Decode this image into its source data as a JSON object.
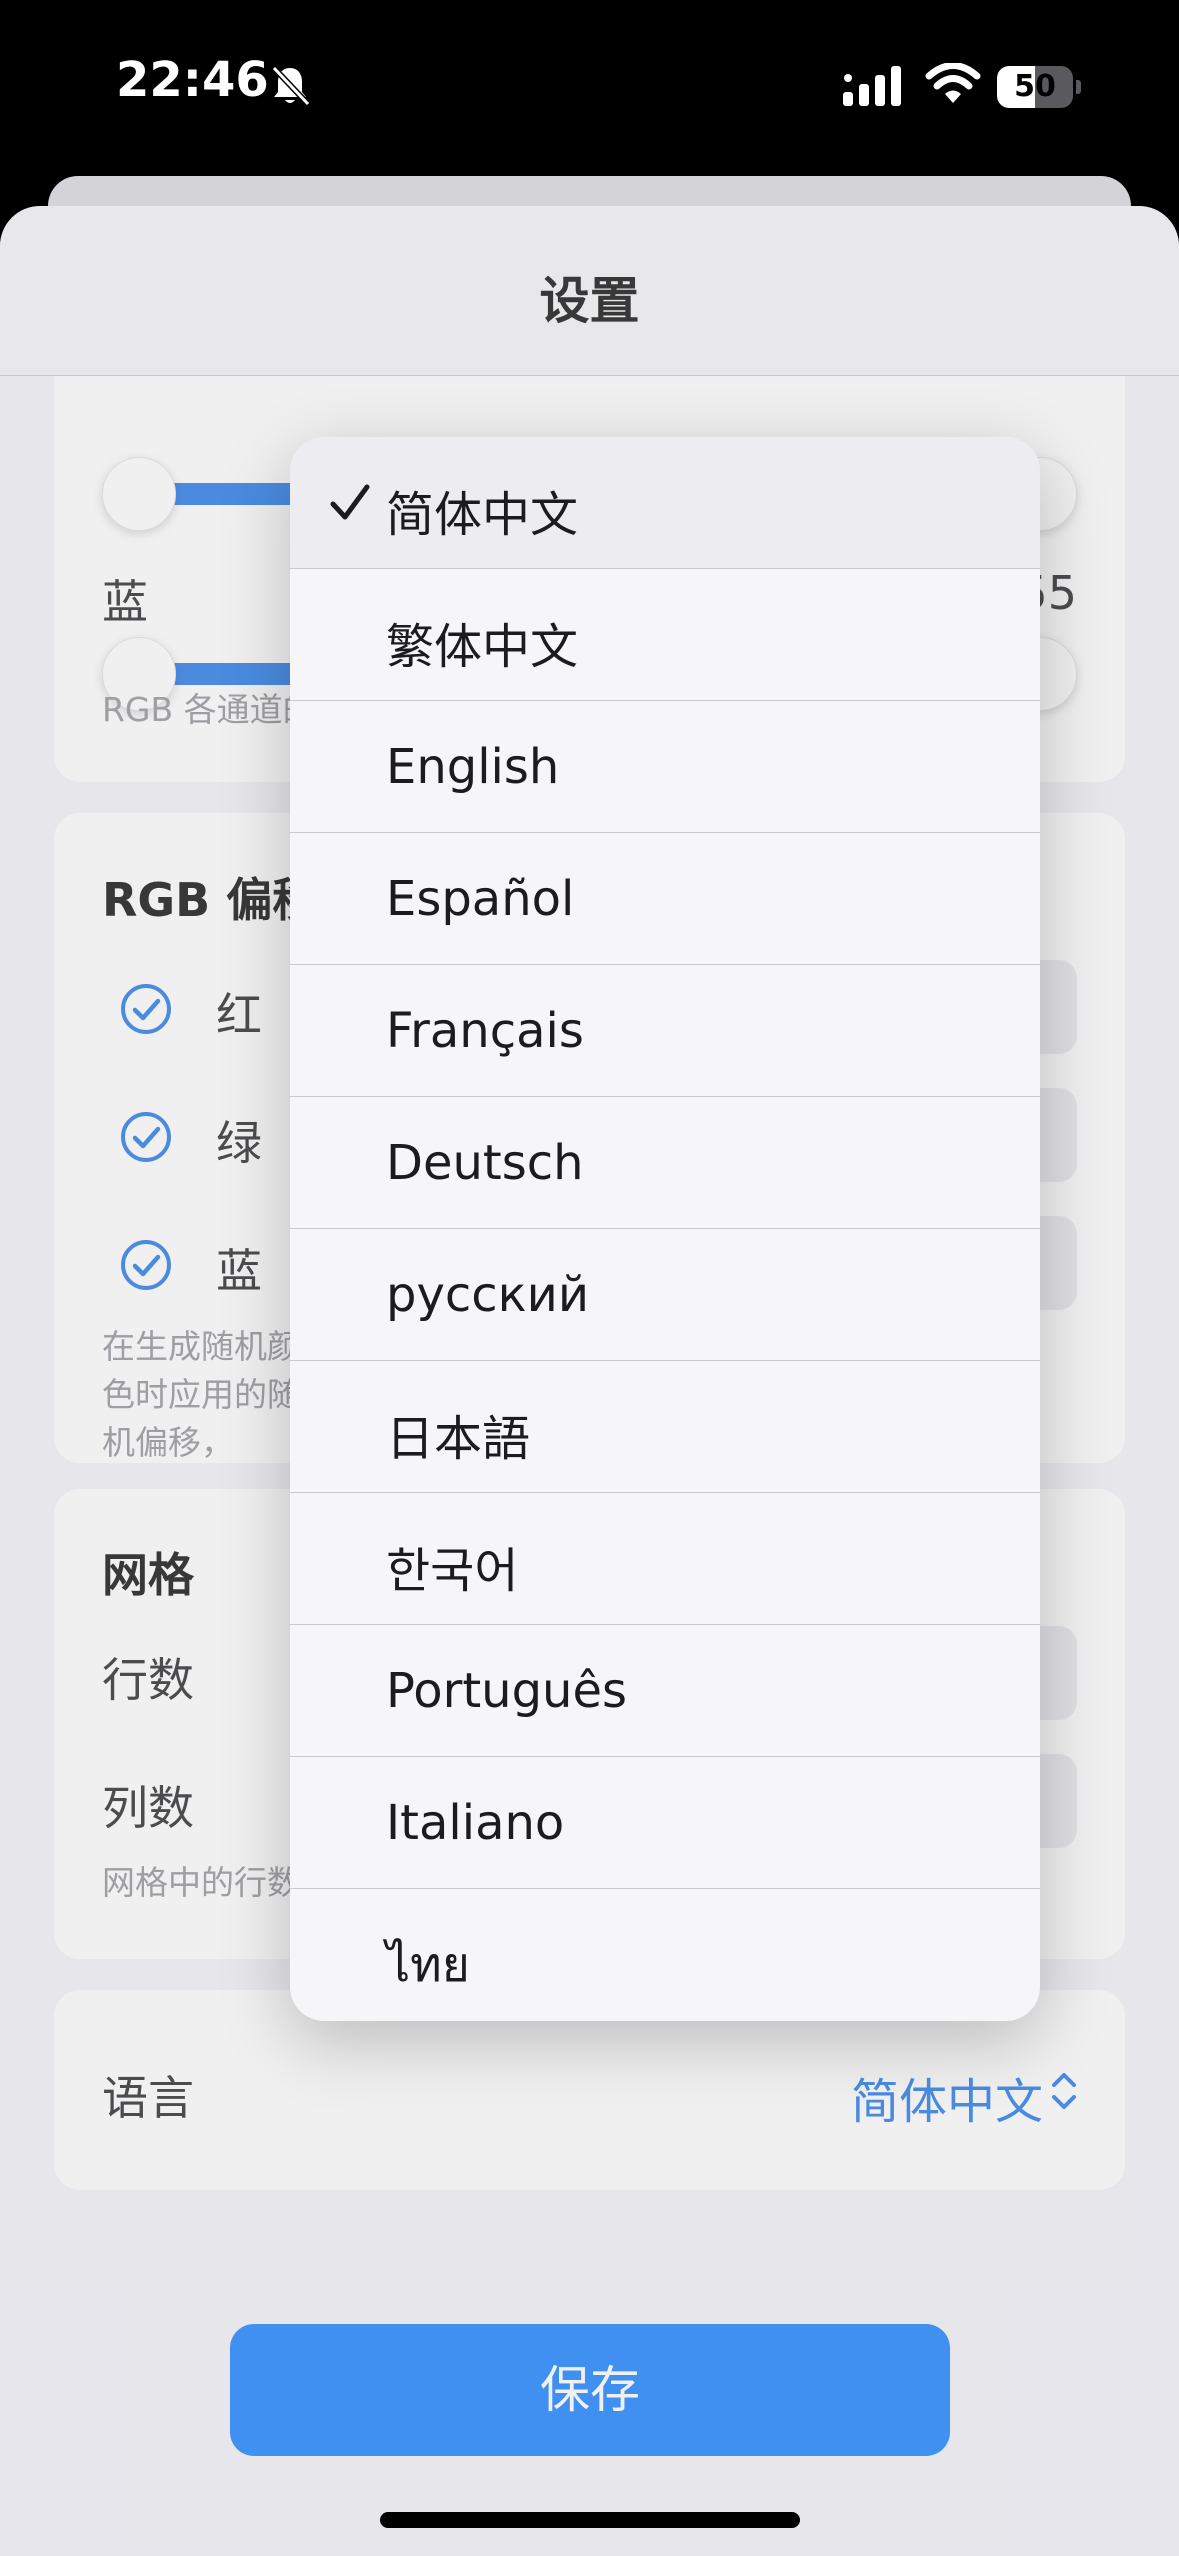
{
  "status_bar": {
    "time": "22:46",
    "battery": "50",
    "battery_level": 0.5
  },
  "nav": {
    "title": "设置"
  },
  "color_card": {
    "blue_label": "蓝",
    "blue_value": "255",
    "footnote": "RGB 各通道的值范围为 0 到 255"
  },
  "rgb_offset": {
    "heading": "RGB 偏移",
    "rows": [
      {
        "label": "红",
        "checked": true
      },
      {
        "label": "绿",
        "checked": true
      },
      {
        "label": "蓝",
        "checked": true
      }
    ],
    "footnote": "在生成随机颜色时应用的随机偏移，"
  },
  "grid": {
    "heading": "网格",
    "rows_label": "行数",
    "cols_label": "列数",
    "footnote": "网格中的行数"
  },
  "language": {
    "label": "语言",
    "value": "简体中文"
  },
  "save_button": "保存",
  "language_menu": {
    "selected_index": 0,
    "options": [
      "简体中文",
      "繁体中文",
      "English",
      "Español",
      "Français",
      "Deutsch",
      "русский",
      "日本語",
      "한국어",
      "Português",
      "Italiano",
      "ไทย"
    ]
  },
  "icons": {
    "bell": "bell-slash-icon",
    "signal": "cellular-signal-icon",
    "wifi": "wifi-icon",
    "check": "checkmark-circle-icon",
    "menu_check": "checkmark-icon",
    "updown": "chevron-up-down-icon"
  },
  "colors": {
    "accent": "#0a7aff",
    "slider": "#1a73e8"
  }
}
